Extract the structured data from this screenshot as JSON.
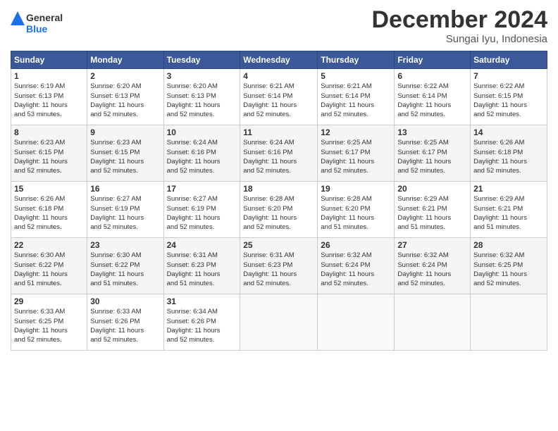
{
  "logo": {
    "line1": "General",
    "line2": "Blue"
  },
  "title": "December 2024",
  "subtitle": "Sungai Iyu, Indonesia",
  "weekdays": [
    "Sunday",
    "Monday",
    "Tuesday",
    "Wednesday",
    "Thursday",
    "Friday",
    "Saturday"
  ],
  "weeks": [
    [
      {
        "day": "1",
        "info": "Sunrise: 6:19 AM\nSunset: 6:13 PM\nDaylight: 11 hours\nand 53 minutes."
      },
      {
        "day": "2",
        "info": "Sunrise: 6:20 AM\nSunset: 6:13 PM\nDaylight: 11 hours\nand 52 minutes."
      },
      {
        "day": "3",
        "info": "Sunrise: 6:20 AM\nSunset: 6:13 PM\nDaylight: 11 hours\nand 52 minutes."
      },
      {
        "day": "4",
        "info": "Sunrise: 6:21 AM\nSunset: 6:14 PM\nDaylight: 11 hours\nand 52 minutes."
      },
      {
        "day": "5",
        "info": "Sunrise: 6:21 AM\nSunset: 6:14 PM\nDaylight: 11 hours\nand 52 minutes."
      },
      {
        "day": "6",
        "info": "Sunrise: 6:22 AM\nSunset: 6:14 PM\nDaylight: 11 hours\nand 52 minutes."
      },
      {
        "day": "7",
        "info": "Sunrise: 6:22 AM\nSunset: 6:15 PM\nDaylight: 11 hours\nand 52 minutes."
      }
    ],
    [
      {
        "day": "8",
        "info": "Sunrise: 6:23 AM\nSunset: 6:15 PM\nDaylight: 11 hours\nand 52 minutes."
      },
      {
        "day": "9",
        "info": "Sunrise: 6:23 AM\nSunset: 6:15 PM\nDaylight: 11 hours\nand 52 minutes."
      },
      {
        "day": "10",
        "info": "Sunrise: 6:24 AM\nSunset: 6:16 PM\nDaylight: 11 hours\nand 52 minutes."
      },
      {
        "day": "11",
        "info": "Sunrise: 6:24 AM\nSunset: 6:16 PM\nDaylight: 11 hours\nand 52 minutes."
      },
      {
        "day": "12",
        "info": "Sunrise: 6:25 AM\nSunset: 6:17 PM\nDaylight: 11 hours\nand 52 minutes."
      },
      {
        "day": "13",
        "info": "Sunrise: 6:25 AM\nSunset: 6:17 PM\nDaylight: 11 hours\nand 52 minutes."
      },
      {
        "day": "14",
        "info": "Sunrise: 6:26 AM\nSunset: 6:18 PM\nDaylight: 11 hours\nand 52 minutes."
      }
    ],
    [
      {
        "day": "15",
        "info": "Sunrise: 6:26 AM\nSunset: 6:18 PM\nDaylight: 11 hours\nand 52 minutes."
      },
      {
        "day": "16",
        "info": "Sunrise: 6:27 AM\nSunset: 6:19 PM\nDaylight: 11 hours\nand 52 minutes."
      },
      {
        "day": "17",
        "info": "Sunrise: 6:27 AM\nSunset: 6:19 PM\nDaylight: 11 hours\nand 52 minutes."
      },
      {
        "day": "18",
        "info": "Sunrise: 6:28 AM\nSunset: 6:20 PM\nDaylight: 11 hours\nand 52 minutes."
      },
      {
        "day": "19",
        "info": "Sunrise: 6:28 AM\nSunset: 6:20 PM\nDaylight: 11 hours\nand 51 minutes."
      },
      {
        "day": "20",
        "info": "Sunrise: 6:29 AM\nSunset: 6:21 PM\nDaylight: 11 hours\nand 51 minutes."
      },
      {
        "day": "21",
        "info": "Sunrise: 6:29 AM\nSunset: 6:21 PM\nDaylight: 11 hours\nand 51 minutes."
      }
    ],
    [
      {
        "day": "22",
        "info": "Sunrise: 6:30 AM\nSunset: 6:22 PM\nDaylight: 11 hours\nand 51 minutes."
      },
      {
        "day": "23",
        "info": "Sunrise: 6:30 AM\nSunset: 6:22 PM\nDaylight: 11 hours\nand 51 minutes."
      },
      {
        "day": "24",
        "info": "Sunrise: 6:31 AM\nSunset: 6:23 PM\nDaylight: 11 hours\nand 51 minutes."
      },
      {
        "day": "25",
        "info": "Sunrise: 6:31 AM\nSunset: 6:23 PM\nDaylight: 11 hours\nand 52 minutes."
      },
      {
        "day": "26",
        "info": "Sunrise: 6:32 AM\nSunset: 6:24 PM\nDaylight: 11 hours\nand 52 minutes."
      },
      {
        "day": "27",
        "info": "Sunrise: 6:32 AM\nSunset: 6:24 PM\nDaylight: 11 hours\nand 52 minutes."
      },
      {
        "day": "28",
        "info": "Sunrise: 6:32 AM\nSunset: 6:25 PM\nDaylight: 11 hours\nand 52 minutes."
      }
    ],
    [
      {
        "day": "29",
        "info": "Sunrise: 6:33 AM\nSunset: 6:25 PM\nDaylight: 11 hours\nand 52 minutes."
      },
      {
        "day": "30",
        "info": "Sunrise: 6:33 AM\nSunset: 6:26 PM\nDaylight: 11 hours\nand 52 minutes."
      },
      {
        "day": "31",
        "info": "Sunrise: 6:34 AM\nSunset: 6:26 PM\nDaylight: 11 hours\nand 52 minutes."
      },
      {
        "day": "",
        "info": ""
      },
      {
        "day": "",
        "info": ""
      },
      {
        "day": "",
        "info": ""
      },
      {
        "day": "",
        "info": ""
      }
    ]
  ]
}
